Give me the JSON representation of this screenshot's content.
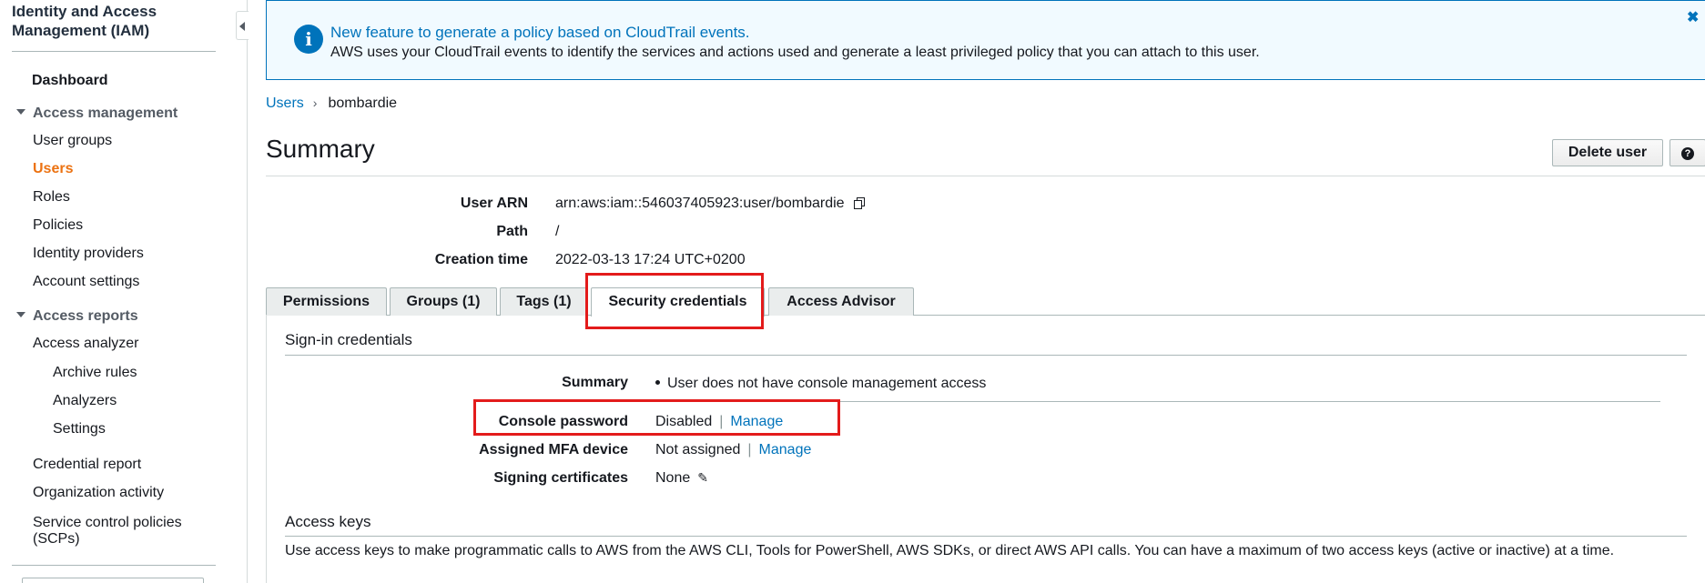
{
  "sidebar": {
    "title": "Identity and Access Management (IAM)",
    "dashboard": "Dashboard",
    "access_management": {
      "label": "Access management",
      "items": [
        "User groups",
        "Users",
        "Roles",
        "Policies",
        "Identity providers",
        "Account settings"
      ],
      "active": "Users"
    },
    "access_reports": {
      "label": "Access reports",
      "analyzer": "Access analyzer",
      "analyzer_items": [
        "Archive rules",
        "Analyzers",
        "Settings"
      ],
      "items": [
        "Credential report",
        "Organization activity",
        "Service control policies (SCPs)"
      ]
    }
  },
  "banner": {
    "title": "New feature to generate a policy based on CloudTrail events.",
    "text": "AWS uses your CloudTrail events to identify the services and actions used and generate a least privileged policy that you can attach to this user.",
    "info_icon": "info-icon",
    "close_icon": "close-icon",
    "info_glyph": "i",
    "close_glyph": "✖"
  },
  "breadcrumb": {
    "parent": "Users",
    "separator": "›",
    "current": "bombardie"
  },
  "summary": {
    "title": "Summary",
    "delete_button": "Delete user",
    "help_glyph": "?",
    "fields": {
      "arn_label": "User ARN",
      "arn_value": "arn:aws:iam::546037405923:user/bombardie",
      "path_label": "Path",
      "path_value": "/",
      "created_label": "Creation time",
      "created_value": "2022-03-13 17:24 UTC+0200"
    }
  },
  "tabs": [
    "Permissions",
    "Groups (1)",
    "Tags (1)",
    "Security credentials",
    "Access Advisor"
  ],
  "active_tab": "Security credentials",
  "signin": {
    "title": "Sign-in credentials",
    "summary_label": "Summary",
    "summary_value": "User does not have console management access",
    "console_label": "Console password",
    "console_value": "Disabled",
    "mfa_label": "Assigned MFA device",
    "mfa_value": "Not assigned",
    "manage_link": "Manage",
    "pipe": "|",
    "certs_label": "Signing certificates",
    "certs_value": "None",
    "pencil_glyph": "✎"
  },
  "access_keys": {
    "title": "Access keys",
    "description": "Use access keys to make programmatic calls to AWS from the AWS CLI, Tools for PowerShell, AWS SDKs, or direct AWS API calls. You can have a maximum of two access keys (active or inactive) at a time."
  },
  "colors": {
    "link": "#0073bb",
    "active_nav": "#ec7211",
    "highlight": "#e31b1b",
    "banner_bg": "#f1faff"
  }
}
